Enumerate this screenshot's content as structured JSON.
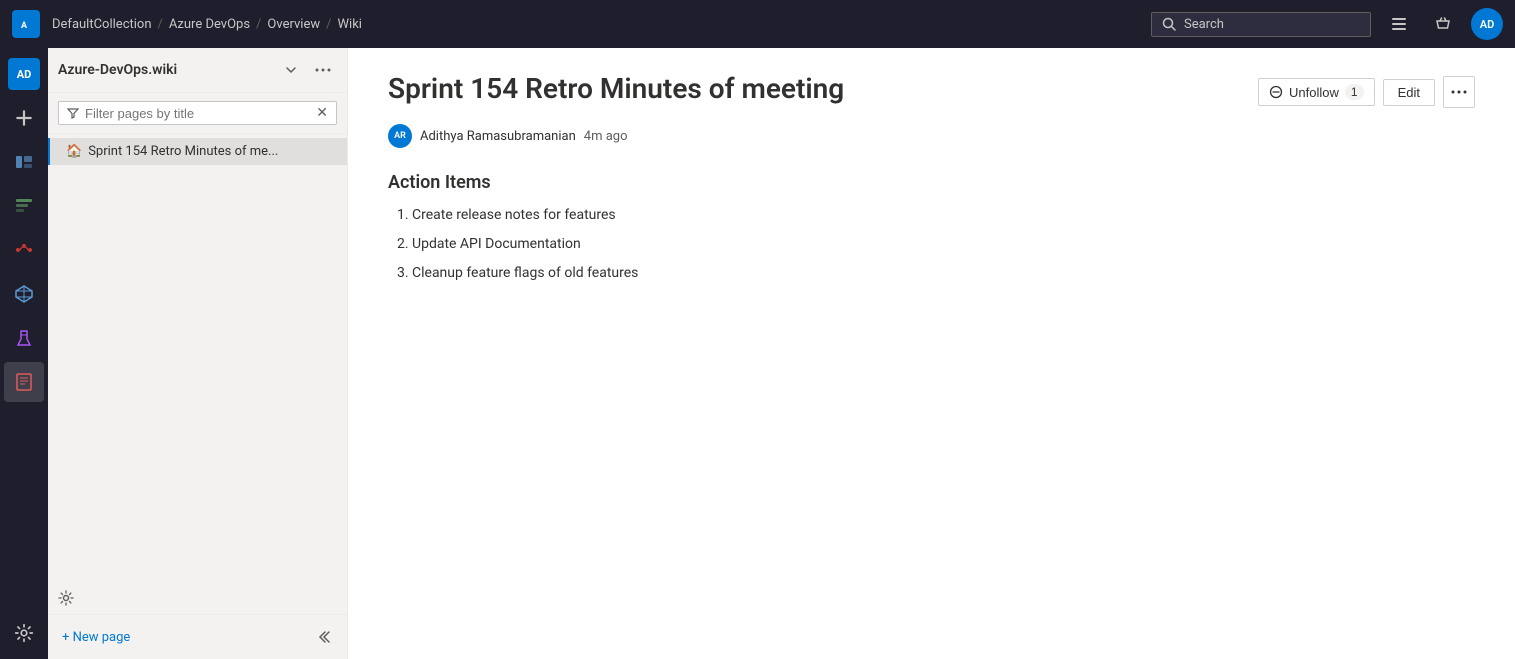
{
  "topNav": {
    "logo_label": "AD",
    "breadcrumbs": [
      {
        "label": "DefaultCollection",
        "href": "#"
      },
      {
        "label": "Azure DevOps",
        "href": "#"
      },
      {
        "label": "Overview",
        "href": "#"
      },
      {
        "label": "Wiki",
        "href": "#"
      }
    ],
    "search_placeholder": "Search",
    "icons_menu": "≡",
    "icons_bag": "🛍",
    "avatar_initials": "AD"
  },
  "activityBar": {
    "items": [
      {
        "name": "add",
        "icon": "+"
      },
      {
        "name": "boards",
        "icon": "📋"
      },
      {
        "name": "sprints",
        "icon": "📊"
      },
      {
        "name": "pipelines",
        "icon": "🔴"
      },
      {
        "name": "artifacts",
        "icon": "🔷"
      },
      {
        "name": "test",
        "icon": "🧪"
      },
      {
        "name": "wiki",
        "icon": "📕"
      }
    ]
  },
  "sidebar": {
    "wiki_name": "Azure-DevOps.wiki",
    "filter_placeholder": "Filter pages by title",
    "tree_item": "Sprint 154 Retro Minutes of me...",
    "new_page_label": "+ New page",
    "collapse_icon": "⟪"
  },
  "content": {
    "page_title": "Sprint 154 Retro Minutes of meeting",
    "author_initials": "AR",
    "author_name": "Adithya Ramasubramanian",
    "time_ago": "4m ago",
    "unfollow_label": "Unfollow",
    "follow_count": "1",
    "edit_label": "Edit",
    "section_title": "Action Items",
    "action_items": [
      "Create release notes for features",
      "Update API Documentation",
      "Cleanup feature flags of old features"
    ]
  }
}
